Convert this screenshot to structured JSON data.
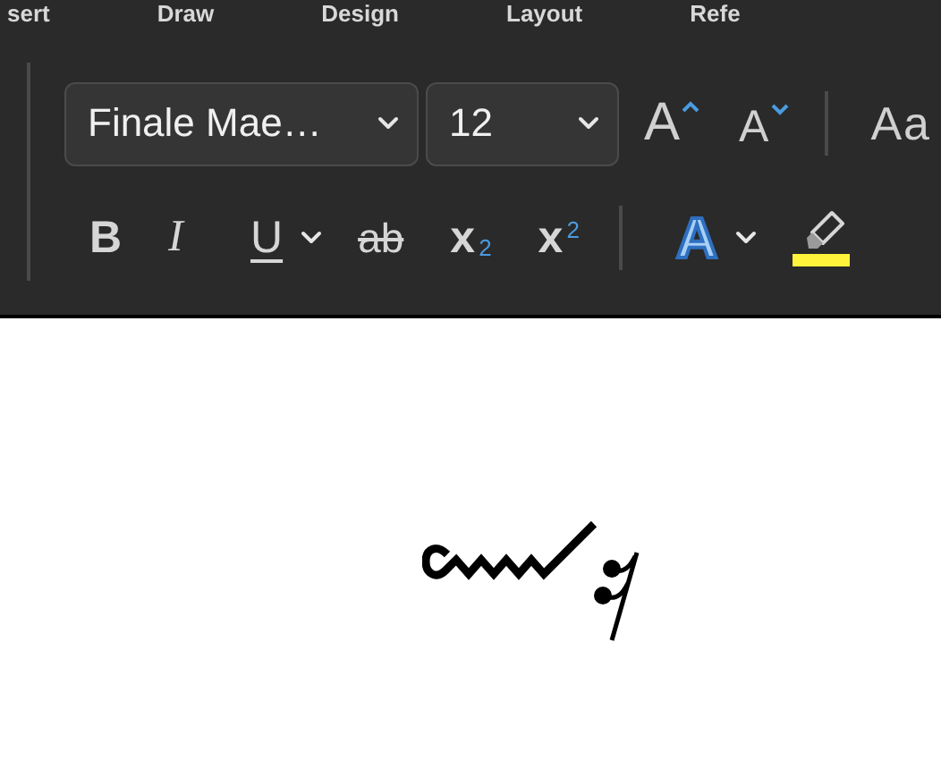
{
  "menu_tabs": [
    "sert",
    "Draw",
    "Design",
    "Layout",
    "Refe"
  ],
  "font_name": {
    "value": "Finale Mae…"
  },
  "font_size": {
    "value": "12"
  },
  "size_tools": [
    {
      "kind": "grow",
      "glyph": "A"
    },
    {
      "kind": "shrink",
      "glyph": "A"
    }
  ],
  "case_tool": {
    "glyph": "Aa"
  },
  "format_tools": [
    {
      "kind": "bold",
      "glyph": "B"
    },
    {
      "kind": "italic",
      "glyph": "I"
    },
    {
      "kind": "underline",
      "glyph": "U"
    },
    {
      "kind": "menu_arrow"
    },
    {
      "kind": "strikethrough",
      "glyph": "ab"
    },
    {
      "kind": "subscript",
      "glyph": "x",
      "index": "2"
    },
    {
      "kind": "superscript",
      "glyph": "x",
      "index": "2"
    },
    {
      "kind": "separator"
    },
    {
      "kind": "effects",
      "glyph": "A"
    },
    {
      "kind": "menu_arrow"
    },
    {
      "kind": "highlight"
    }
  ]
}
